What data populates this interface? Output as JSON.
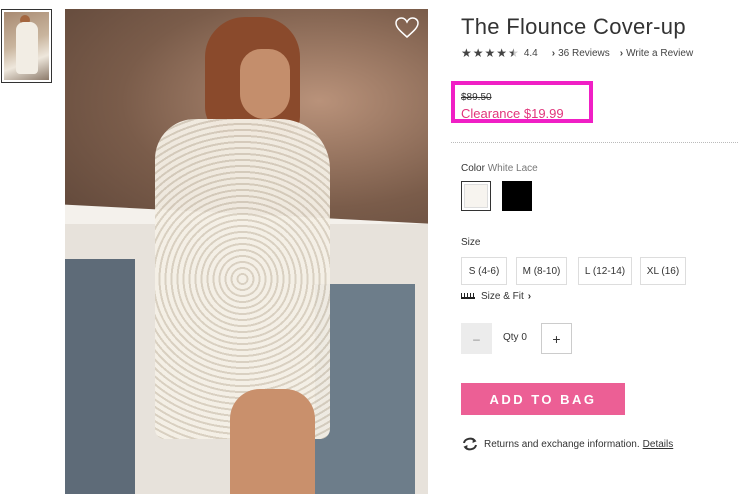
{
  "product": {
    "title": "The Flounce Cover-up",
    "rating": "4.4",
    "stars_filled": 4.5,
    "reviews_link": "36 Reviews",
    "write_review_link": "Write a Review"
  },
  "pricing": {
    "original_price": "$89.50",
    "sale_price": "Clearance $19.99",
    "highlight_color": "#f01fc5",
    "sale_color": "#e0367c"
  },
  "color": {
    "label": "Color",
    "selected_value": "White Lace",
    "swatches": [
      "white-lace",
      "black"
    ]
  },
  "size": {
    "label": "Size",
    "options": [
      "S (4-6)",
      "M (8-10)",
      "L (12-14)",
      "XL (16)"
    ],
    "size_fit_link": "Size & Fit"
  },
  "quantity": {
    "label": "Qty",
    "value": "0",
    "minus": "–",
    "plus": "+"
  },
  "cart": {
    "add_to_bag_label": "ADD TO BAG",
    "button_color": "#ec5f95"
  },
  "returns": {
    "text": "Returns and exchange information.",
    "details_link": "Details"
  },
  "icons": {
    "wishlist": "heart-icon",
    "returns": "refresh-icon",
    "size_fit": "ruler-icon"
  }
}
